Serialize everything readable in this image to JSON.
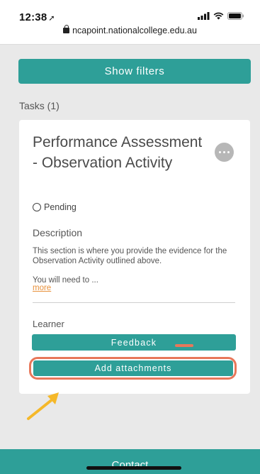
{
  "status_bar": {
    "time": "12:38",
    "url": "ncapoint.nationalcollege.edu.au"
  },
  "filters": {
    "button_label": "Show filters"
  },
  "tasks": {
    "label": "Tasks (1)",
    "items": [
      {
        "title": "Performance Assessment - Observation Activity",
        "status": "Pending",
        "description_heading": "Description",
        "description": "This section is where you provide the evidence for the Observation Activity outlined above.",
        "description_more_text": "You will need to ...",
        "more_link": "more",
        "learner_label": "Learner",
        "feedback_label": "Feedback",
        "attachments_label": "Add attachments"
      }
    ]
  },
  "footer": {
    "contact_label": "Contact"
  },
  "colors": {
    "accent": "#2e9f98",
    "highlight": "#e8775a",
    "link": "#e8913b",
    "annotation_arrow": "#f5b829"
  }
}
